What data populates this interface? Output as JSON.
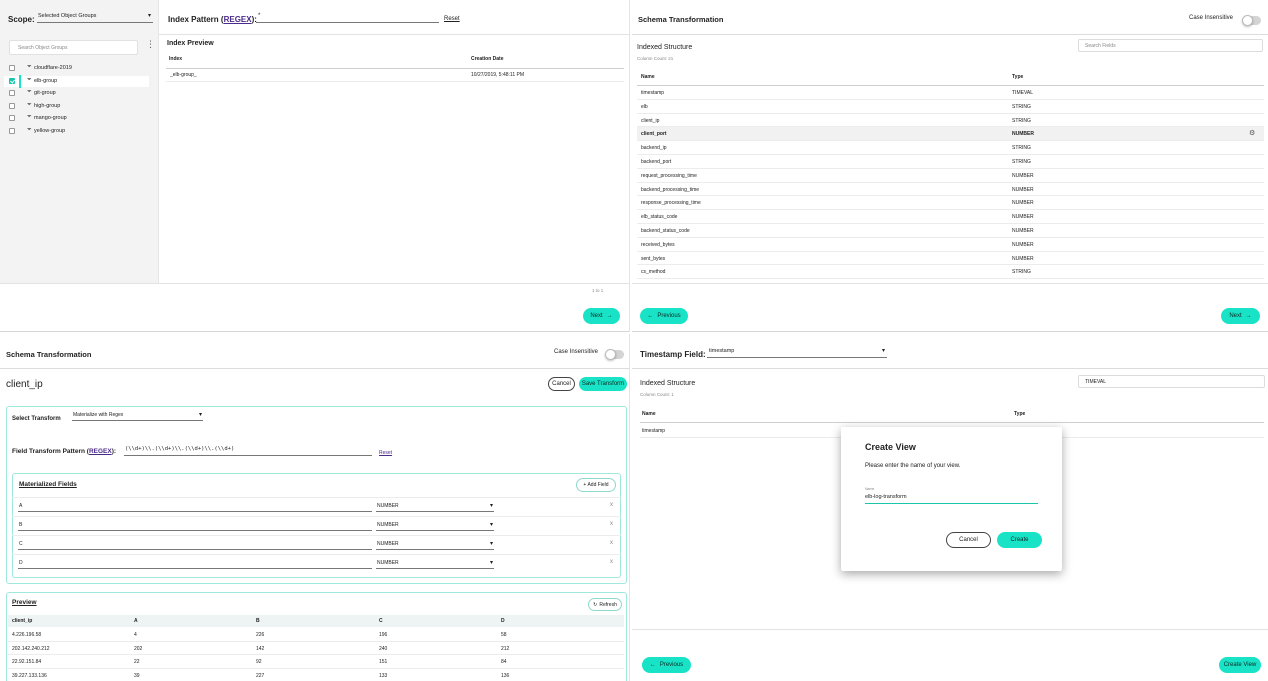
{
  "p1": {
    "scope_label": "Scope:",
    "scope_value": "Selected Object Groups",
    "search_placeholder": "Search Object Groups",
    "groups": [
      {
        "name": "cloudflare-2019",
        "checked": false
      },
      {
        "name": "elb-group",
        "checked": true
      },
      {
        "name": "git-group",
        "checked": false
      },
      {
        "name": "high-group",
        "checked": false
      },
      {
        "name": "mango-group",
        "checked": false
      },
      {
        "name": "yellow-group",
        "checked": false
      }
    ],
    "index_pattern_label": "Index Pattern (",
    "regex_link": "REGEX",
    "index_pattern_suffix": "):",
    "index_pattern_value": "*",
    "reset": "Reset",
    "preview_title": "Index Preview",
    "col_index": "Index",
    "col_date": "Creation Date",
    "rows": [
      {
        "index": "_elb-group_",
        "date": "10/27/2019, 5:48:11 PM"
      }
    ],
    "pagination": "1 to 1",
    "next": "Next"
  },
  "p2": {
    "title": "Schema Transformation",
    "case_label": "Case Insensitive",
    "structure_title": "Indexed Structure",
    "column_count": "Column Count: 21",
    "search_placeholder": "Search Fields",
    "col_name": "Name",
    "col_type": "Type",
    "rows": [
      {
        "name": "timestamp",
        "type": "TIMEVAL"
      },
      {
        "name": "elb",
        "type": "STRING"
      },
      {
        "name": "client_ip",
        "type": "STRING"
      },
      {
        "name": "client_port",
        "type": "NUMBER"
      },
      {
        "name": "backend_ip",
        "type": "STRING"
      },
      {
        "name": "backend_port",
        "type": "STRING"
      },
      {
        "name": "request_processing_time",
        "type": "NUMBER"
      },
      {
        "name": "backend_processing_time",
        "type": "NUMBER"
      },
      {
        "name": "response_processing_time",
        "type": "NUMBER"
      },
      {
        "name": "elb_status_code",
        "type": "NUMBER"
      },
      {
        "name": "backend_status_code",
        "type": "NUMBER"
      },
      {
        "name": "received_bytes",
        "type": "NUMBER"
      },
      {
        "name": "sent_bytes",
        "type": "NUMBER"
      },
      {
        "name": "cs_method",
        "type": "STRING"
      }
    ],
    "highlighted_row": 3,
    "previous": "Previous",
    "next": "Next"
  },
  "p3": {
    "title": "Schema Transformation",
    "case_label": "Case Insensitive",
    "field_name": "client_ip",
    "cancel": "Cancel",
    "save": "Save Transform",
    "select_label": "Select Transform",
    "select_value": "Materialize with Regex",
    "pattern_label": "Field Transform Pattern (",
    "regex_link": "REGEX",
    "pattern_suffix": "):",
    "pattern_value": "(\\\\d+)\\\\.(\\\\d+)\\\\.(\\\\d+)\\\\.(\\\\d+)",
    "reset": "Reset",
    "materialized_title": "Materialized Fields",
    "add_field": "+ Add Field",
    "fields": [
      {
        "name": "A",
        "type": "NUMBER"
      },
      {
        "name": "B",
        "type": "NUMBER"
      },
      {
        "name": "C",
        "type": "NUMBER"
      },
      {
        "name": "D",
        "type": "NUMBER"
      }
    ],
    "remove": "x",
    "preview_title": "Preview",
    "refresh": "Refresh",
    "preview_cols": [
      "client_ip",
      "A",
      "B",
      "C",
      "D"
    ],
    "preview_rows": [
      [
        "4.226.196.58",
        "4",
        "226",
        "196",
        "58"
      ],
      [
        "202.142.240.212",
        "202",
        "142",
        "240",
        "212"
      ],
      [
        "22.92.151.84",
        "22",
        "92",
        "151",
        "84"
      ],
      [
        "39.227.133.136",
        "39",
        "227",
        "133",
        "136"
      ]
    ]
  },
  "p4": {
    "ts_label": "Timestamp Field:",
    "ts_value": "timestamp",
    "structure_title": "Indexed Structure",
    "column_count": "Column Count: 1",
    "search_value": "TIMEVAL",
    "col_name": "Name",
    "col_type": "Type",
    "rows": [
      {
        "name": "timestamp",
        "type": ""
      }
    ],
    "dialog_title": "Create View",
    "dialog_text": "Please enter the name of your view.",
    "dialog_field_label": "Name",
    "dialog_field_value": "elb-log-transform",
    "dialog_cancel": "Cancel",
    "dialog_create": "Create",
    "previous": "Previous",
    "create_view": "Create View"
  },
  "colors": {
    "accent": "#19e3c6",
    "sidebar": "#f3f3f3",
    "highlight": "#f1f1f1"
  }
}
